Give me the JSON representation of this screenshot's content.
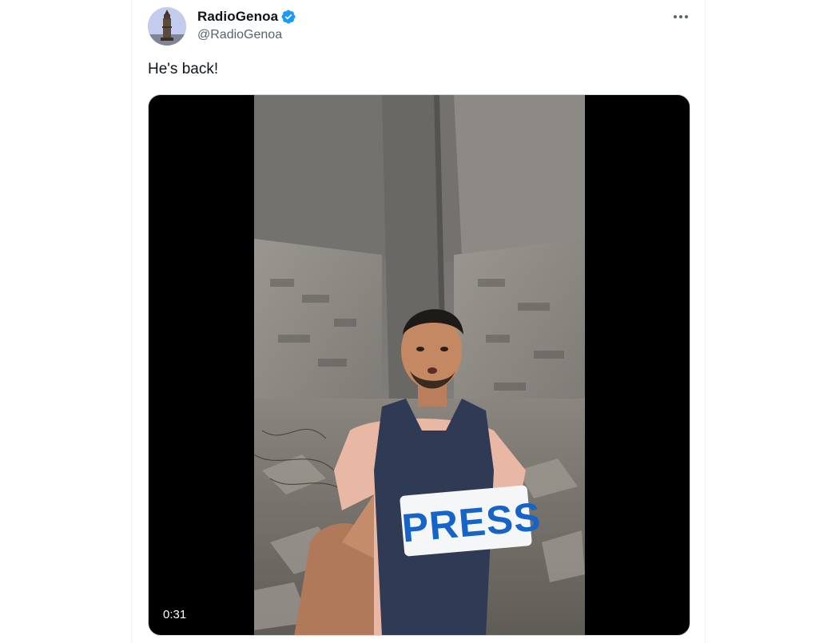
{
  "tweet": {
    "author": {
      "display_name": "RadioGenoa",
      "handle": "@RadioGenoa",
      "verified": true,
      "verified_color": "#1d9bf0"
    },
    "text": "He's back!",
    "media": {
      "type": "video",
      "duration": "0:31",
      "vest_label": "PRESS"
    }
  },
  "icons": {
    "avatar": "lighthouse-avatar",
    "verified": "verified-badge-icon",
    "more": "more-options-icon"
  },
  "colors": {
    "text_primary": "#0f1419",
    "text_secondary": "#536471",
    "accent": "#1d9bf0"
  }
}
